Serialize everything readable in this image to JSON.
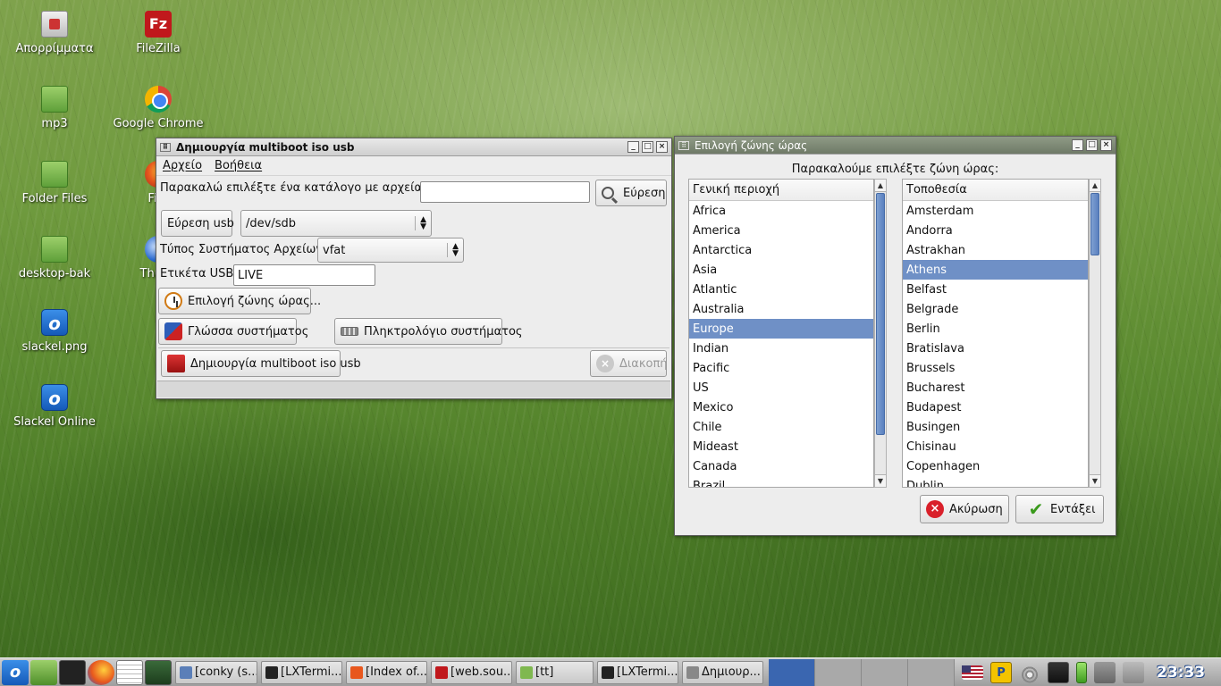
{
  "desktop": {
    "icons": [
      {
        "label": "Απορρίμματα",
        "icon": "trash-icon"
      },
      {
        "label": "FileZilla",
        "icon": "filezilla-icon"
      },
      {
        "label": "mp3",
        "icon": "folder-icon"
      },
      {
        "label": "Google Chrome",
        "icon": "chrome-icon"
      },
      {
        "label": "Folder Files",
        "icon": "folder-icon"
      },
      {
        "label": "Fire",
        "icon": "firefox-icon"
      },
      {
        "label": "desktop-bak",
        "icon": "folder-icon"
      },
      {
        "label": "Thund",
        "icon": "thunderbird-icon"
      },
      {
        "label": "slackel.png",
        "icon": "slackel-icon"
      },
      {
        "label": "Slackel Online",
        "icon": "slackel-icon"
      }
    ]
  },
  "multiboot_window": {
    "title": "Δημιουργία multiboot iso usb",
    "menu": {
      "file": "Αρχείο",
      "help": "Βοήθεια"
    },
    "iso_dir_label": "Παρακαλώ επιλέξτε ένα κατάλογο με αρχεία iso.",
    "iso_dir_value": "",
    "find_button": "Εύρεση",
    "find_usb_button": "Εύρεση usb",
    "usb_device": "/dev/sdb",
    "fs_type_label": "Τύπος Συστήματος Αρχείων:",
    "fs_type": "vfat",
    "usb_label_label": "Ετικέτα USB:",
    "usb_label_value": "LIVE",
    "timezone_button": "Επιλογή ζώνης ώρας...",
    "language_button": "Γλώσσα συστήματος",
    "keyboard_button": "Πληκτρολόγιο συστήματος",
    "create_button": "Δημιουργία multiboot iso usb",
    "stop_button": "Διακοπή"
  },
  "timezone_window": {
    "title": "Επιλογή ζώνης ώρας",
    "prompt": "Παρακαλούμε επιλέξτε ζώνη ώρας:",
    "region_header": "Γενική περιοχή",
    "regions": [
      "Africa",
      "America",
      "Antarctica",
      "Asia",
      "Atlantic",
      "Australia",
      "Europe",
      "Indian",
      "Pacific",
      "US",
      "Mexico",
      "Chile",
      "Mideast",
      "Canada",
      "Brazil"
    ],
    "selected_region": "Europe",
    "location_header": "Τοποθεσία",
    "locations": [
      "Amsterdam",
      "Andorra",
      "Astrakhan",
      "Athens",
      "Belfast",
      "Belgrade",
      "Berlin",
      "Bratislava",
      "Brussels",
      "Bucharest",
      "Budapest",
      "Busingen",
      "Chisinau",
      "Copenhagen",
      "Dublin"
    ],
    "selected_location": "Athens",
    "cancel_button": "Ακύρωση",
    "ok_button": "Εντάξει"
  },
  "taskbar": {
    "tasks": [
      {
        "label": "[conky (s...",
        "icon": "window-icon"
      },
      {
        "label": "[LXTermi...",
        "icon": "terminal-icon"
      },
      {
        "label": "[Index of...",
        "icon": "firefox-icon"
      },
      {
        "label": "[web.sou...",
        "icon": "filezilla-icon"
      },
      {
        "label": "[tt]",
        "icon": "folder-icon"
      },
      {
        "label": "[LXTermi...",
        "icon": "terminal-icon"
      },
      {
        "label": "Δημιουρ...",
        "icon": "app-icon"
      }
    ],
    "clock": "23:33"
  },
  "colors": {
    "selection": "#6f90c6",
    "taskbar_active": "#3a66b0"
  }
}
